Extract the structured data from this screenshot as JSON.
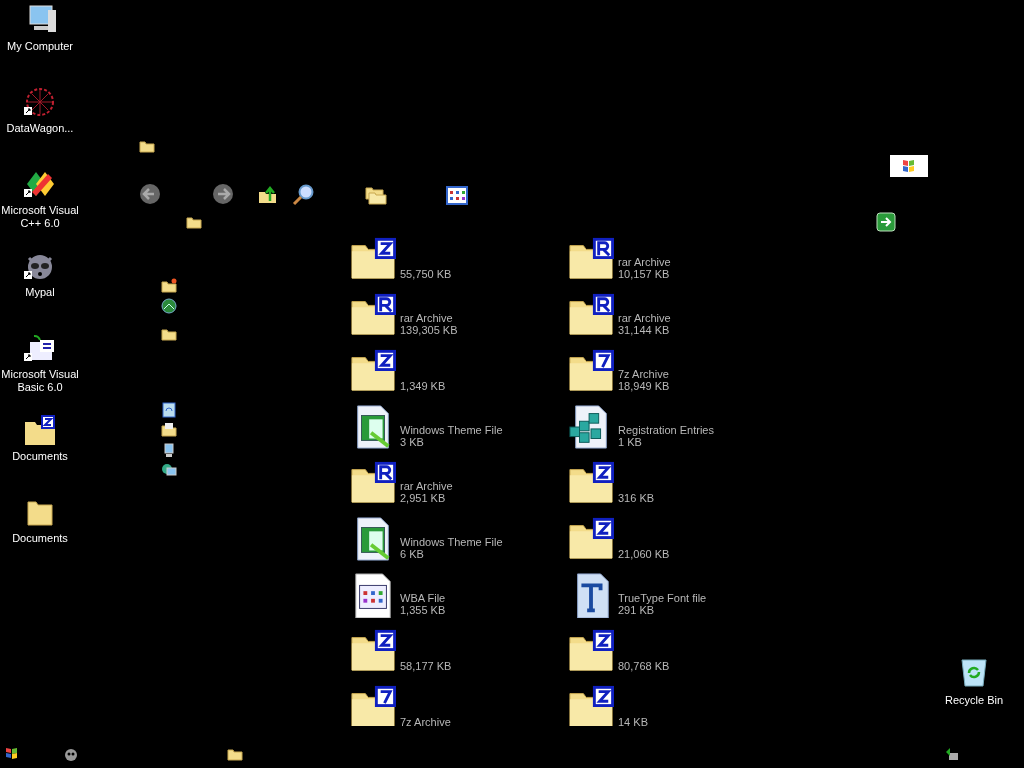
{
  "desktop_icons": [
    {
      "kind": "computer",
      "label": "My Computer"
    },
    {
      "kind": "datawagon",
      "label": "DataWagon..."
    },
    {
      "kind": "vcpp",
      "label": "Microsoft Visual C++ 6.0"
    },
    {
      "kind": "mypal",
      "label": "Mypal"
    },
    {
      "kind": "vb",
      "label": "Microsoft Visual Basic 6.0"
    },
    {
      "kind": "zip",
      "label": "Documents"
    },
    {
      "kind": "folder",
      "label": "Documents"
    }
  ],
  "recycle_bin": {
    "label": "Recycle Bin"
  },
  "files": [
    {
      "kind": "zip",
      "size": "55,750 KB"
    },
    {
      "kind": "rar",
      "type": "rar Archive",
      "size": "139,305 KB"
    },
    {
      "kind": "zip",
      "size": "1,349 KB"
    },
    {
      "kind": "theme",
      "type": "Windows Theme File",
      "size": "3 KB"
    },
    {
      "kind": "rar",
      "type": "rar Archive",
      "size": "2,951 KB"
    },
    {
      "kind": "theme",
      "type": "Windows Theme File",
      "size": "6 KB"
    },
    {
      "kind": "wba",
      "type": "WBA File",
      "size": "1,355 KB"
    },
    {
      "kind": "zip",
      "size": "58,177 KB"
    },
    {
      "kind": "sevenzip",
      "type": "7z Archive"
    },
    {
      "kind": "rar",
      "type": "rar Archive",
      "size": "10,157 KB"
    },
    {
      "kind": "rar",
      "type": "rar Archive",
      "size": "31,144 KB"
    },
    {
      "kind": "sevenzip",
      "type": "7z Archive",
      "size": "18,949 KB"
    },
    {
      "kind": "reg",
      "type": "Registration Entries",
      "size": "1 KB"
    },
    {
      "kind": "zip",
      "size": "316 KB"
    },
    {
      "kind": "zip",
      "size": "21,060 KB"
    },
    {
      "kind": "ttf",
      "type": "TrueType Font file",
      "size": "291 KB"
    },
    {
      "kind": "zip",
      "size": "80,768 KB"
    },
    {
      "kind": "zip",
      "size": "14 KB"
    }
  ]
}
